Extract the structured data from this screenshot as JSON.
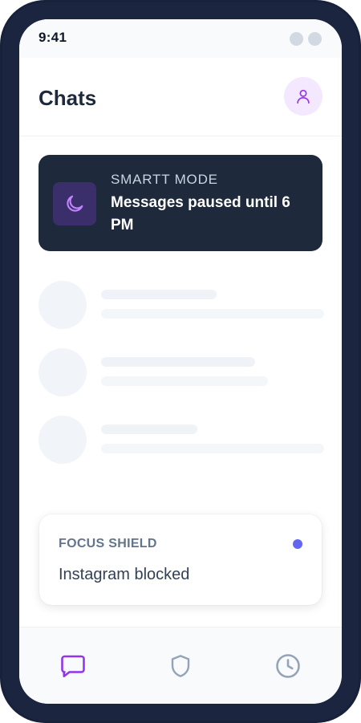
{
  "status_bar": {
    "time": "9:41"
  },
  "header": {
    "title": "Chats",
    "avatar_icon": "user-icon"
  },
  "smart_mode": {
    "label": "SMARTT MODE",
    "message": "Messages paused until 6 PM",
    "icon": "moon-icon"
  },
  "chat_list": {
    "state": "loading",
    "placeholder_rows": 3
  },
  "focus_shield": {
    "label": "FOCUS SHIELD",
    "status": "Instagram blocked",
    "indicator_color": "#6366f1"
  },
  "tab_bar": {
    "tabs": [
      {
        "id": "chats",
        "icon": "chat-bubble-icon",
        "active": true
      },
      {
        "id": "shield",
        "icon": "shield-icon",
        "active": false
      },
      {
        "id": "history",
        "icon": "clock-icon",
        "active": false
      }
    ]
  },
  "colors": {
    "accent": "#9333ea",
    "dark_card": "#1e293b",
    "inactive_icon": "#94a3b8"
  }
}
